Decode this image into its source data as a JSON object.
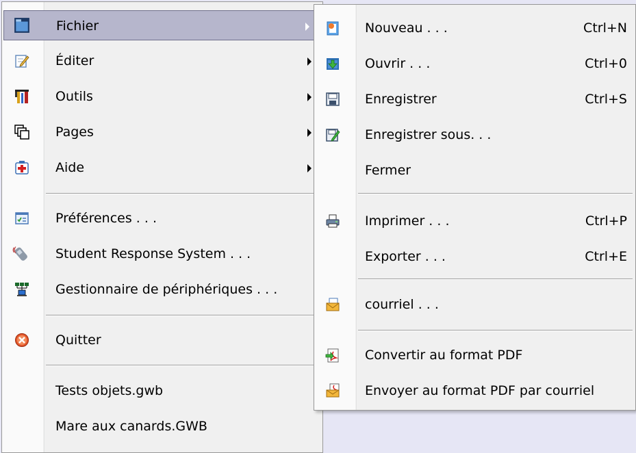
{
  "main_menu": {
    "items": [
      {
        "label": "Fichier",
        "icon": "folder-icon"
      },
      {
        "label": "Éditer",
        "icon": "edit-icon"
      },
      {
        "label": "Outils",
        "icon": "tools-icon"
      },
      {
        "label": "Pages",
        "icon": "pages-icon"
      },
      {
        "label": "Aide",
        "icon": "help-icon"
      },
      {
        "label": "Préférences . . .",
        "icon": "preferences-icon"
      },
      {
        "label": "Student Response System . . .",
        "icon": "response-system-icon"
      },
      {
        "label": "Gestionnaire de périphériques . . .",
        "icon": "device-manager-icon"
      },
      {
        "label": "Quitter",
        "icon": "quit-icon"
      },
      {
        "label": "Tests objets.gwb"
      },
      {
        "label": "Mare aux canards.GWB"
      }
    ]
  },
  "submenu": {
    "items": [
      {
        "label": "Nouveau . . .",
        "shortcut": "Ctrl+N",
        "icon": "new-document-icon"
      },
      {
        "label": "Ouvrir . . .",
        "shortcut": "Ctrl+0",
        "icon": "open-icon"
      },
      {
        "label": "Enregistrer",
        "shortcut": "Ctrl+S",
        "icon": "save-icon"
      },
      {
        "label": "Enregistrer sous. . .",
        "icon": "save-as-icon"
      },
      {
        "label": "Fermer"
      },
      {
        "label": "Imprimer . . .",
        "shortcut": "Ctrl+P",
        "icon": "print-icon"
      },
      {
        "label": "Exporter . . .",
        "shortcut": "Ctrl+E"
      },
      {
        "label": "courriel . . .",
        "icon": "email-icon"
      },
      {
        "label": "Convertir au format PDF",
        "icon": "convert-pdf-icon"
      },
      {
        "label": "Envoyer au format PDF par courriel",
        "icon": "email-pdf-icon"
      }
    ]
  },
  "colors": {
    "highlight": "#b6b6cc",
    "menu_background": "#f0f0f0",
    "page_background": "#e6e6f5"
  }
}
